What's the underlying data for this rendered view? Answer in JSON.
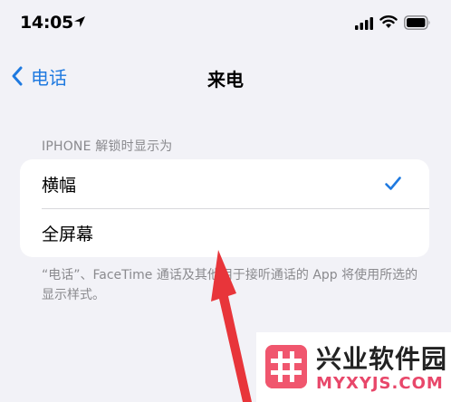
{
  "status_bar": {
    "time": "14:05",
    "icons": [
      "location-arrow-icon",
      "cellular-signal-icon",
      "wifi-icon",
      "battery-icon"
    ]
  },
  "nav": {
    "back_label": "电话",
    "title": "来电"
  },
  "section": {
    "header": "IPHONE 解锁时显示为",
    "options": [
      {
        "label": "横幅",
        "selected": true
      },
      {
        "label": "全屏幕",
        "selected": false
      }
    ],
    "footer": "“电话”、FaceTime 通话及其他用于接听通话的 App 将使用所选的显示样式。"
  },
  "watermark": {
    "title": "兴业软件园",
    "url": "MYXYJS.COM"
  },
  "colors": {
    "accent": "#1f7ae0",
    "background": "#f2f2f7",
    "secondary_text": "#8a8a8e",
    "arrow": "#e8353a",
    "watermark_brand": "#f0566e"
  }
}
